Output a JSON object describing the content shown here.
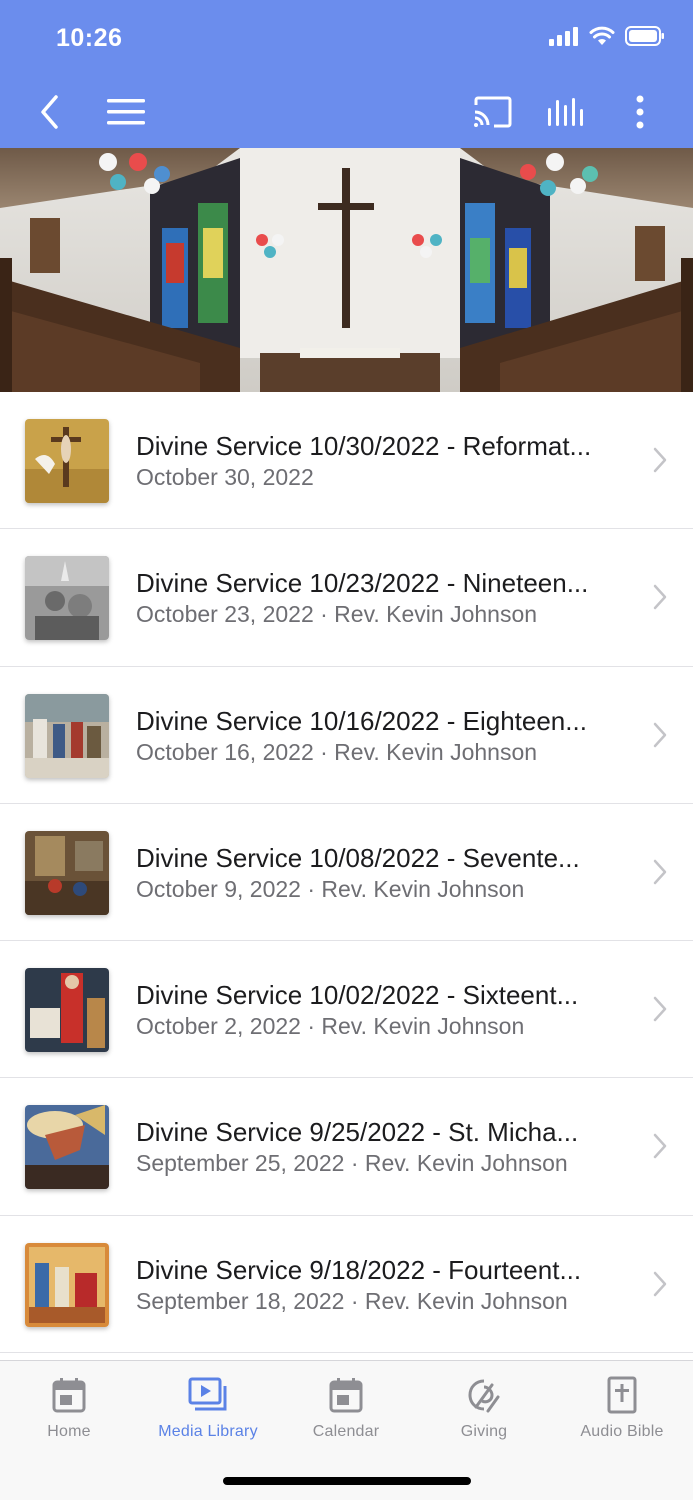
{
  "status": {
    "time": "10:26"
  },
  "colors": {
    "header": "#6b8ded",
    "active_tab": "#5b82e6",
    "inactive_tab": "#8e8e93"
  },
  "toolbar": {
    "back_icon": "chevron-left-icon",
    "menu_icon": "hamburger-icon",
    "cast_icon": "cast-icon",
    "audio_icon": "audio-bars-icon",
    "more_icon": "more-vertical-icon"
  },
  "media_items": [
    {
      "title": "Divine Service 10/30/2022 - Reformat...",
      "subtitle": "October 30, 2022"
    },
    {
      "title": "Divine Service 10/23/2022 - Nineteen...",
      "subtitle": "October 23, 2022 · Rev. Kevin Johnson"
    },
    {
      "title": "Divine Service 10/16/2022 - Eighteen...",
      "subtitle": "October 16, 2022 · Rev. Kevin Johnson"
    },
    {
      "title": "Divine Service 10/08/2022 - Sevente...",
      "subtitle": "October 9, 2022 · Rev. Kevin Johnson"
    },
    {
      "title": "Divine Service 10/02/2022 - Sixteent...",
      "subtitle": "October 2, 2022 · Rev. Kevin Johnson"
    },
    {
      "title": "Divine Service 9/25/2022 - St. Micha...",
      "subtitle": "September 25, 2022 · Rev. Kevin Johnson"
    },
    {
      "title": "Divine Service 9/18/2022 - Fourteent...",
      "subtitle": "September 18, 2022 · Rev. Kevin Johnson"
    }
  ],
  "tabs": [
    {
      "label": "Home",
      "icon": "calendar-icon",
      "active": false
    },
    {
      "label": "Media Library",
      "icon": "media-library-icon",
      "active": true
    },
    {
      "label": "Calendar",
      "icon": "calendar-icon",
      "active": false
    },
    {
      "label": "Giving",
      "icon": "giving-icon",
      "active": false
    },
    {
      "label": "Audio Bible",
      "icon": "bible-icon",
      "active": false
    }
  ]
}
